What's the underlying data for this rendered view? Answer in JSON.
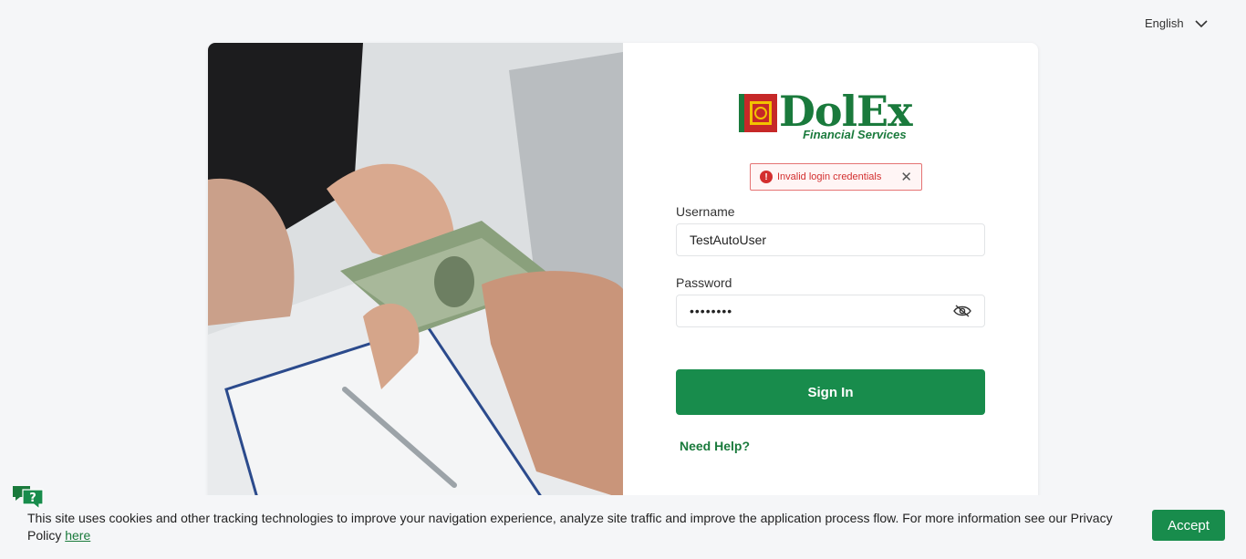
{
  "language": {
    "selected": "English"
  },
  "brand": {
    "name": "DolEx",
    "subtitle": "Financial Services"
  },
  "alert": {
    "message": "Invalid login credentials"
  },
  "form": {
    "username_label": "Username",
    "username_value": "TestAutoUser",
    "password_label": "Password",
    "password_masked": "••••••••",
    "signin_label": "Sign In",
    "help_label": "Need Help?"
  },
  "cookie": {
    "text": "This site uses cookies and other tracking technologies to improve your navigation experience, analyze site traffic and improve the application process flow. For more information see our Privacy Policy ",
    "link_label": "here",
    "accept_label": "Accept"
  },
  "colors": {
    "brand_green": "#188c4c",
    "error_red": "#d32f2f",
    "logo_red": "#c62828",
    "logo_yellow": "#f2c200"
  },
  "icons": {
    "language_chevron": "chevron-down-icon",
    "alert": "error-icon",
    "alert_close": "close-icon",
    "password_toggle": "eye-slash-icon",
    "chat": "chat-help-icon"
  }
}
